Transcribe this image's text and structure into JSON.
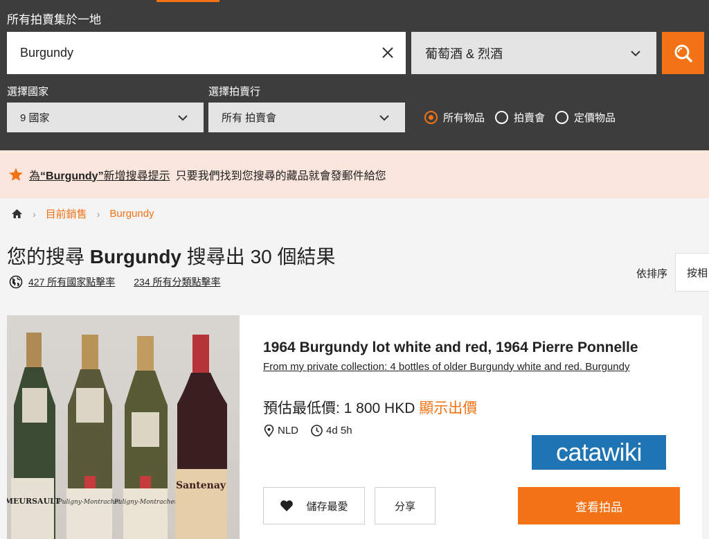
{
  "search": {
    "panel_title": "所有拍賣集於一地",
    "query": "Burgundy",
    "category": "葡萄酒 & 烈酒"
  },
  "filters": {
    "country_label": "選擇國家",
    "country_value": "9 國家",
    "house_label": "選擇拍賣行",
    "house_value": "所有 拍賣會",
    "radio_options": [
      {
        "label": "所有物品",
        "selected": true
      },
      {
        "label": "拍賣會",
        "selected": false
      },
      {
        "label": "定價物品",
        "selected": false
      }
    ]
  },
  "alert": {
    "prefix": "為",
    "term": "“Burgundy”",
    "link_suffix": "新增搜尋提示",
    "message": "只要我們找到您搜尋的藏品就會發郵件給您"
  },
  "breadcrumb": {
    "current_sales": "目前銷售",
    "term": "Burgundy"
  },
  "results": {
    "prefix": "您的搜尋",
    "term": "Burgundy",
    "suffix": "搜尋出 30 個結果",
    "country_hits": "427 所有國家點擊率",
    "category_hits": "234 所有分類點擊率",
    "sort_label": "依排序",
    "sort_value": "按相"
  },
  "lot": {
    "title": "1964 Burgundy lot white and red, 1964 Pierre Ponnelle",
    "description": "From my private collection: 4 bottles of older Burgundy white and red. Burgundy",
    "price_label": "預估最低價: 1 800 HKD",
    "price_link": "顯示出價",
    "country": "NLD",
    "time_left": "4d 5h",
    "auction_house": "catawiki",
    "bottle_labels": [
      "MEURSAULT",
      "Puligny-Montrachet",
      "Puligny-Montrachet",
      "Santenay"
    ],
    "save_label": "儲存最愛",
    "share_label": "分享",
    "view_label": "查看拍品"
  },
  "colors": {
    "accent": "#f47216",
    "panel": "#3d3d3d",
    "alert_bg": "#fbe6de",
    "catawiki_blue": "#1f74b3"
  }
}
